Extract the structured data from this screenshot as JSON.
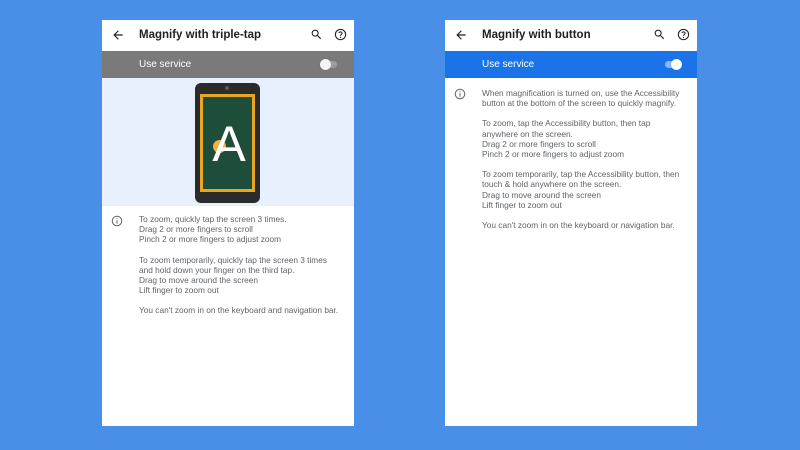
{
  "panels": [
    {
      "title": "Magnify with triple-tap",
      "service": {
        "label": "Use service",
        "enabled": false
      },
      "illustration": {
        "letter": "A"
      },
      "paragraphs": [
        [
          "To zoom, quickly tap the screen 3 times.",
          "Drag 2 or more fingers to scroll",
          "Pinch 2 or more fingers to adjust zoom"
        ],
        [
          "To zoom temporarily, quickly tap the screen 3 times",
          "and hold down your finger on the third tap.",
          "Drag to move around the screen",
          "Lift finger to zoom out"
        ],
        [
          "You can't zoom in on the keyboard and navigation bar."
        ]
      ]
    },
    {
      "title": "Magnify with button",
      "service": {
        "label": "Use service",
        "enabled": true
      },
      "paragraphs": [
        [
          "When magnification is turned on, use the Accessibility",
          "button at the bottom of the screen to quickly magnify."
        ],
        [
          "To zoom, tap the Accessibility button, then tap",
          "anywhere on the screen.",
          "Drag 2 or more fingers to scroll",
          "Pinch 2 or more fingers to adjust zoom"
        ],
        [
          "To zoom temporarily, tap the Accessibility button, then",
          "touch & hold anywhere on the screen.",
          "Drag to move around the screen",
          "Lift finger to zoom out"
        ],
        [
          "You can't zoom in on the keyboard or navigation bar."
        ]
      ]
    }
  ],
  "icons": {
    "back": "arrow-back-icon",
    "search": "search-icon",
    "help": "help-icon",
    "info": "info-icon"
  },
  "colors": {
    "background": "#4a8fe7",
    "service_off_bar": "#7a7a7a",
    "service_on_bar": "#1a73e8",
    "illustration_bg": "#e8f0fe",
    "board": "#1e4d3a",
    "board_frame": "#e8a623"
  }
}
